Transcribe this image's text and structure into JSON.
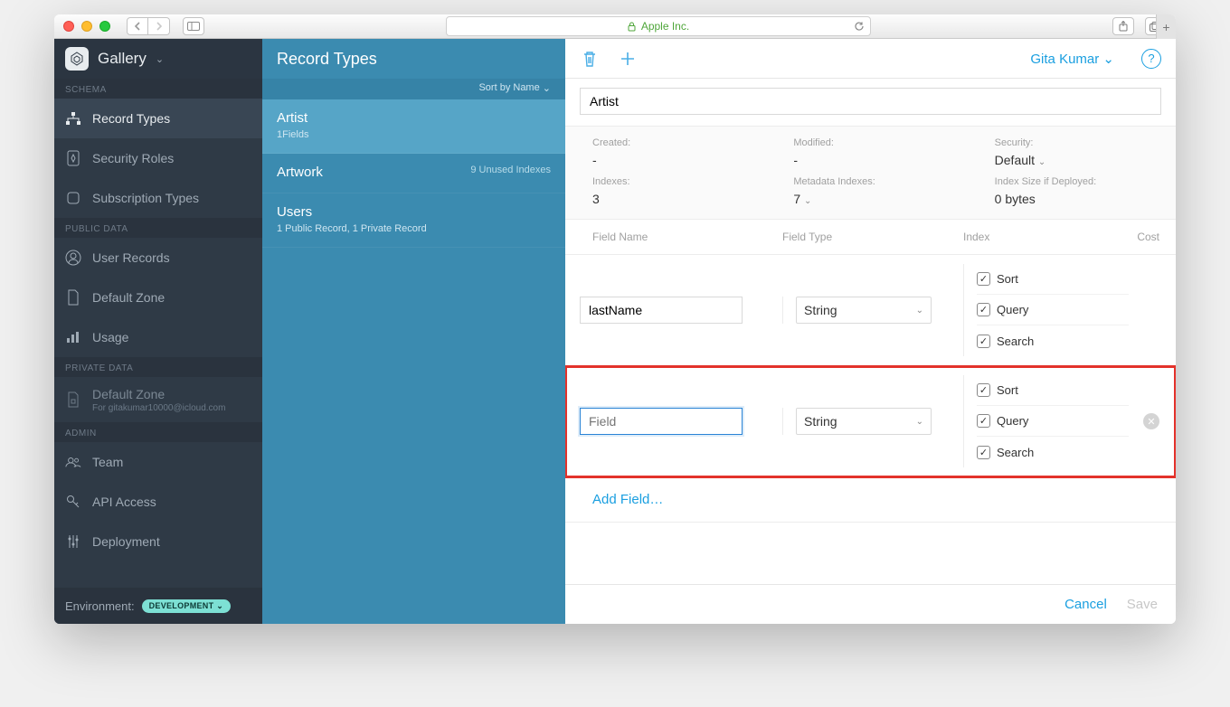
{
  "browser": {
    "domain": "Apple Inc."
  },
  "app": {
    "name": "Gallery"
  },
  "sidebar": {
    "sections": {
      "schema": "SCHEMA",
      "public": "PUBLIC DATA",
      "private": "PRIVATE DATA",
      "admin": "ADMIN"
    },
    "items": {
      "recordTypes": "Record Types",
      "securityRoles": "Security Roles",
      "subscriptionTypes": "Subscription Types",
      "userRecords": "User Records",
      "defaultZone": "Default Zone",
      "usage": "Usage",
      "privateDefaultZone": "Default Zone",
      "privateDefaultZoneSub": "For gitakumar10000@icloud.com",
      "team": "Team",
      "apiAccess": "API Access",
      "deployment": "Deployment"
    },
    "env": {
      "label": "Environment:",
      "value": "DEVELOPMENT"
    }
  },
  "recordsCol": {
    "title": "Record Types",
    "sort": "Sort by Name",
    "items": [
      {
        "title": "Artist",
        "sub": "1Fields",
        "meta": ""
      },
      {
        "title": "Artwork",
        "sub": "",
        "meta": "9 Unused Indexes"
      },
      {
        "title": "Users",
        "sub": "1 Public Record, 1 Private Record",
        "meta": ""
      }
    ]
  },
  "detail": {
    "user": "Gita Kumar",
    "recordName": "Artist",
    "meta": {
      "createdLabel": "Created:",
      "createdValue": "-",
      "modifiedLabel": "Modified:",
      "modifiedValue": "-",
      "securityLabel": "Security:",
      "securityValue": "Default",
      "indexesLabel": "Indexes:",
      "indexesValue": "3",
      "metaIndexesLabel": "Metadata Indexes:",
      "metaIndexesValue": "7",
      "indexSizeLabel": "Index Size if Deployed:",
      "indexSizeValue": "0 bytes"
    },
    "columns": {
      "name": "Field Name",
      "type": "Field Type",
      "index": "Index",
      "cost": "Cost"
    },
    "indexOptions": {
      "sort": "Sort",
      "query": "Query",
      "search": "Search"
    },
    "fields": [
      {
        "name": "lastName",
        "type": "String",
        "placeholder": ""
      },
      {
        "name": "",
        "type": "String",
        "placeholder": "Field"
      }
    ],
    "addField": "Add Field…",
    "footer": {
      "cancel": "Cancel",
      "save": "Save"
    }
  }
}
